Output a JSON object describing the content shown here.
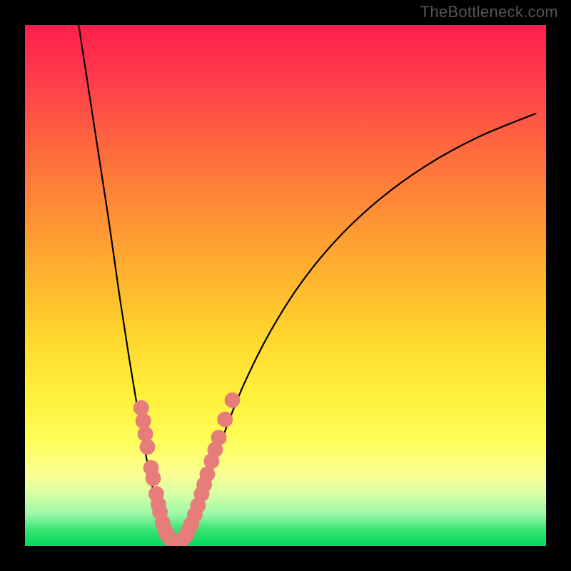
{
  "watermark": "TheBottleneck.com",
  "chart_data": {
    "type": "line",
    "title": "",
    "xlabel": "",
    "ylabel": "",
    "xlim": [
      0,
      100
    ],
    "ylim": [
      0,
      100
    ],
    "grid": false,
    "legend": false,
    "gradient_colors": {
      "top": "#ff1d4d",
      "mid": "#ffd72e",
      "bottom": "#00d85e"
    },
    "series": [
      {
        "name": "left-arm",
        "stroke": "#000000",
        "x": [
          10.3,
          12,
          14,
          16,
          18,
          19,
          20,
          21,
          22,
          23,
          24,
          25,
          26,
          26.8
        ],
        "y": [
          100,
          89,
          76,
          63,
          49,
          42.5,
          36,
          30,
          24,
          18.5,
          13.5,
          9,
          5,
          2.5
        ]
      },
      {
        "name": "bottom",
        "stroke": "#000000",
        "x": [
          26.8,
          27.7,
          29,
          30.2,
          31.4
        ],
        "y": [
          2.5,
          1.2,
          0.5,
          1.2,
          2.5
        ]
      },
      {
        "name": "right-arm",
        "stroke": "#000000",
        "x": [
          31.4,
          33,
          35,
          38,
          42,
          47,
          53,
          60,
          68,
          77,
          87,
          98
        ],
        "y": [
          2.5,
          6,
          12,
          21,
          31,
          41,
          50.5,
          59,
          66.5,
          73,
          78.5,
          83
        ]
      }
    ],
    "dots": {
      "name": "highlight-dots",
      "fill": "#e77d7a",
      "r": 1.5,
      "points": [
        {
          "x": 22.3,
          "y": 26.5
        },
        {
          "x": 22.7,
          "y": 24.0
        },
        {
          "x": 23.1,
          "y": 21.5
        },
        {
          "x": 23.5,
          "y": 19.0
        },
        {
          "x": 24.2,
          "y": 15.0
        },
        {
          "x": 24.6,
          "y": 13.0
        },
        {
          "x": 25.2,
          "y": 10.0
        },
        {
          "x": 25.6,
          "y": 8.0
        },
        {
          "x": 25.9,
          "y": 6.5
        },
        {
          "x": 26.4,
          "y": 4.5
        },
        {
          "x": 26.9,
          "y": 3.0
        },
        {
          "x": 27.4,
          "y": 2.0
        },
        {
          "x": 28.1,
          "y": 1.2
        },
        {
          "x": 28.8,
          "y": 0.8
        },
        {
          "x": 29.5,
          "y": 0.8
        },
        {
          "x": 30.2,
          "y": 1.2
        },
        {
          "x": 30.9,
          "y": 2.0
        },
        {
          "x": 31.4,
          "y": 3.0
        },
        {
          "x": 31.9,
          "y": 4.2
        },
        {
          "x": 32.6,
          "y": 6.0
        },
        {
          "x": 33.2,
          "y": 7.8
        },
        {
          "x": 33.9,
          "y": 10.0
        },
        {
          "x": 34.4,
          "y": 11.8
        },
        {
          "x": 35.0,
          "y": 13.8
        },
        {
          "x": 35.8,
          "y": 16.3
        },
        {
          "x": 36.5,
          "y": 18.5
        },
        {
          "x": 37.2,
          "y": 20.8
        },
        {
          "x": 38.4,
          "y": 24.3
        },
        {
          "x": 39.8,
          "y": 28.0
        }
      ]
    }
  }
}
